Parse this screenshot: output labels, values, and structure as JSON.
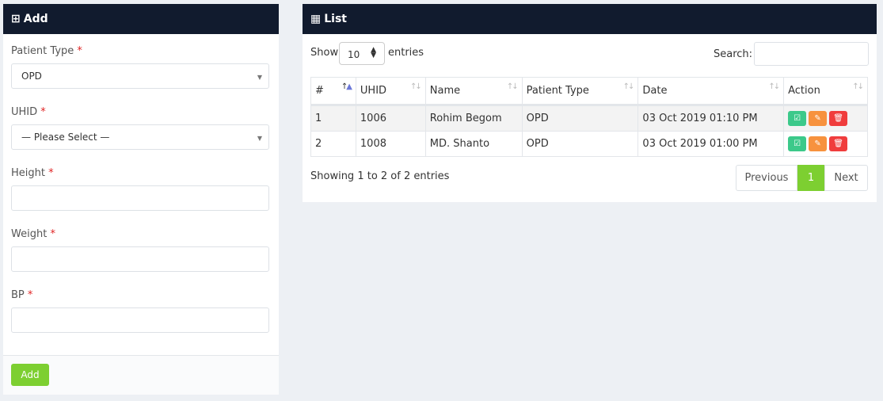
{
  "add_panel": {
    "icon": "plus-square-icon",
    "title": "Add",
    "fields": [
      {
        "label": "Patient Type",
        "required": "*",
        "value": "OPD",
        "type": "select"
      },
      {
        "label": "UHID",
        "required": "*",
        "value": "— Please Select —",
        "type": "select"
      },
      {
        "label": "Height",
        "required": "*",
        "value": "",
        "type": "text"
      },
      {
        "label": "Weight",
        "required": "*",
        "value": "",
        "type": "text"
      },
      {
        "label": "BP",
        "required": "*",
        "value": "",
        "type": "text"
      }
    ],
    "submit_label": "Add"
  },
  "list_panel": {
    "icon": "table-icon",
    "title": "List",
    "show_label": "Show",
    "entries_value": "10",
    "entries_label": "entries",
    "search_label": "Search:",
    "search_value": "",
    "columns": [
      "#",
      "UHID",
      "Name",
      "Patient Type",
      "Date",
      "Action"
    ],
    "rows": [
      {
        "no": "1",
        "uhid": "1006",
        "name": "Rohim Begom",
        "type": "OPD",
        "date": "03 Oct 2019 01:10 PM"
      },
      {
        "no": "2",
        "uhid": "1008",
        "name": "MD. Shanto",
        "type": "OPD",
        "date": "03 Oct 2019 01:00 PM"
      }
    ],
    "info": "Showing 1 to 2 of 2 entries",
    "pagination": {
      "previous": "Previous",
      "current": "1",
      "next": "Next"
    }
  },
  "colors": {
    "header": "#111b2e",
    "view": "#3cc98a",
    "edit": "#f7923e",
    "delete": "#f03d3d",
    "primary": "#7dcf31"
  }
}
